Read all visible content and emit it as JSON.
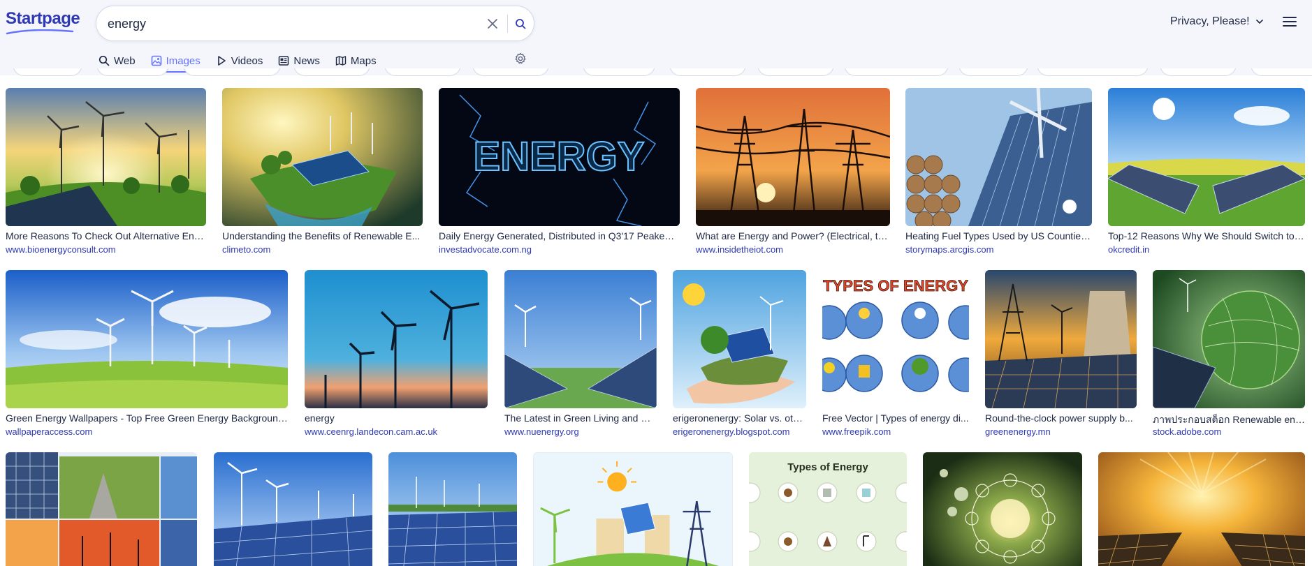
{
  "header": {
    "logo": "Startpage",
    "search": {
      "value": "energy",
      "placeholder": ""
    },
    "privacy_label": "Privacy, Please!",
    "tabs": [
      {
        "label": "Web",
        "icon": "search-icon"
      },
      {
        "label": "Images",
        "icon": "image-icon",
        "active": true
      },
      {
        "label": "Videos",
        "icon": "play-icon"
      },
      {
        "label": "News",
        "icon": "newspaper-icon"
      },
      {
        "label": "Maps",
        "icon": "map-icon"
      }
    ]
  },
  "colors": {
    "accent": "#6573ff",
    "brand": "#2e39b3",
    "text": "#202945",
    "header_bg": "#f4f6fc"
  },
  "results": [
    {
      "title": "More Reasons To Check Out Alternative Ene...",
      "domain": "www.bioenergyconsult.com"
    },
    {
      "title": "Understanding the Benefits of Renewable E...",
      "domain": "climeto.com"
    },
    {
      "title": "Daily Energy Generated, Distributed in Q3'17 Peaked ...",
      "domain": "investadvocate.com.ng",
      "overlay": "ENERGY"
    },
    {
      "title": "What are Energy and Power? (Electrical, th...",
      "domain": "www.insidetheiot.com"
    },
    {
      "title": "Heating Fuel Types Used by US Counties...",
      "domain": "storymaps.arcgis.com"
    },
    {
      "title": "Top-12 Reasons Why We Should Switch to ...",
      "domain": "okcredit.in"
    },
    {
      "title": "Green Energy Wallpapers - Top Free Green Energy Background...",
      "domain": "wallpaperaccess.com"
    },
    {
      "title": "energy",
      "domain": "www.ceenrg.landecon.cam.ac.uk"
    },
    {
      "title": "The Latest in Green Living and Su...",
      "domain": "www.nuenergy.org"
    },
    {
      "title": "erigeronenergy: Solar vs. oth...",
      "domain": "erigeronenergy.blogspot.com"
    },
    {
      "title": "Free Vector | Types of energy di...",
      "domain": "www.freepik.com",
      "overlay": "TYPES OF ENERGY"
    },
    {
      "title": "Round-the-clock power supply b...",
      "domain": "greenenergy.mn"
    },
    {
      "title": "ภาพประกอบสต็อก Renewable ener...",
      "domain": "stock.adobe.com"
    },
    {
      "title": "",
      "domain": ""
    },
    {
      "title": "",
      "domain": ""
    },
    {
      "title": "",
      "domain": ""
    },
    {
      "title": "",
      "domain": ""
    },
    {
      "title": "",
      "domain": "",
      "overlay": "Types of Energy"
    },
    {
      "title": "",
      "domain": ""
    },
    {
      "title": "",
      "domain": ""
    }
  ]
}
